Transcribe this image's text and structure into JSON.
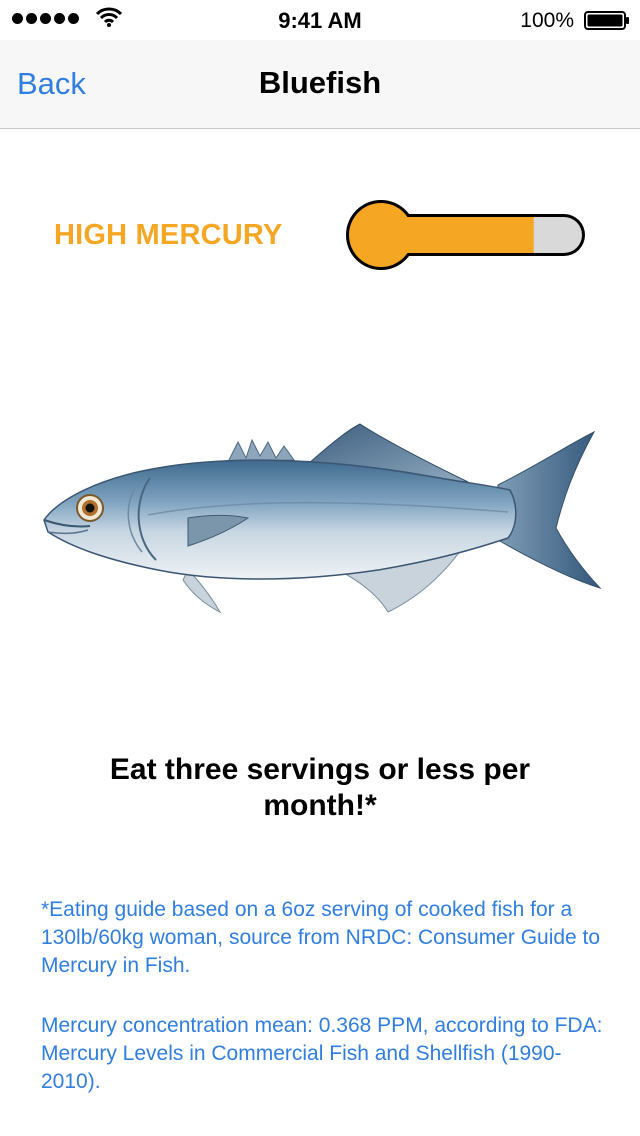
{
  "status_bar": {
    "time": "9:41 AM",
    "battery": "100%"
  },
  "nav": {
    "back_label": "Back",
    "title": "Bluefish"
  },
  "mercury": {
    "label": "HIGH MERCURY",
    "level_fraction": 0.75,
    "fill_color": "#f5a623",
    "empty_color": "#d9d9d9"
  },
  "advice": "Eat three servings or less per month!*",
  "notes": {
    "guide": "*Eating guide based on a 6oz serving of cooked fish for a 130lb/60kg woman, source from NRDC: Consumer Guide to Mercury in Fish.",
    "concentration": "Mercury concentration mean: 0.368 PPM, according to FDA: Mercury Levels in Commercial Fish and Shellfish (1990-2010)."
  },
  "accent_color": "#2f7ee0"
}
